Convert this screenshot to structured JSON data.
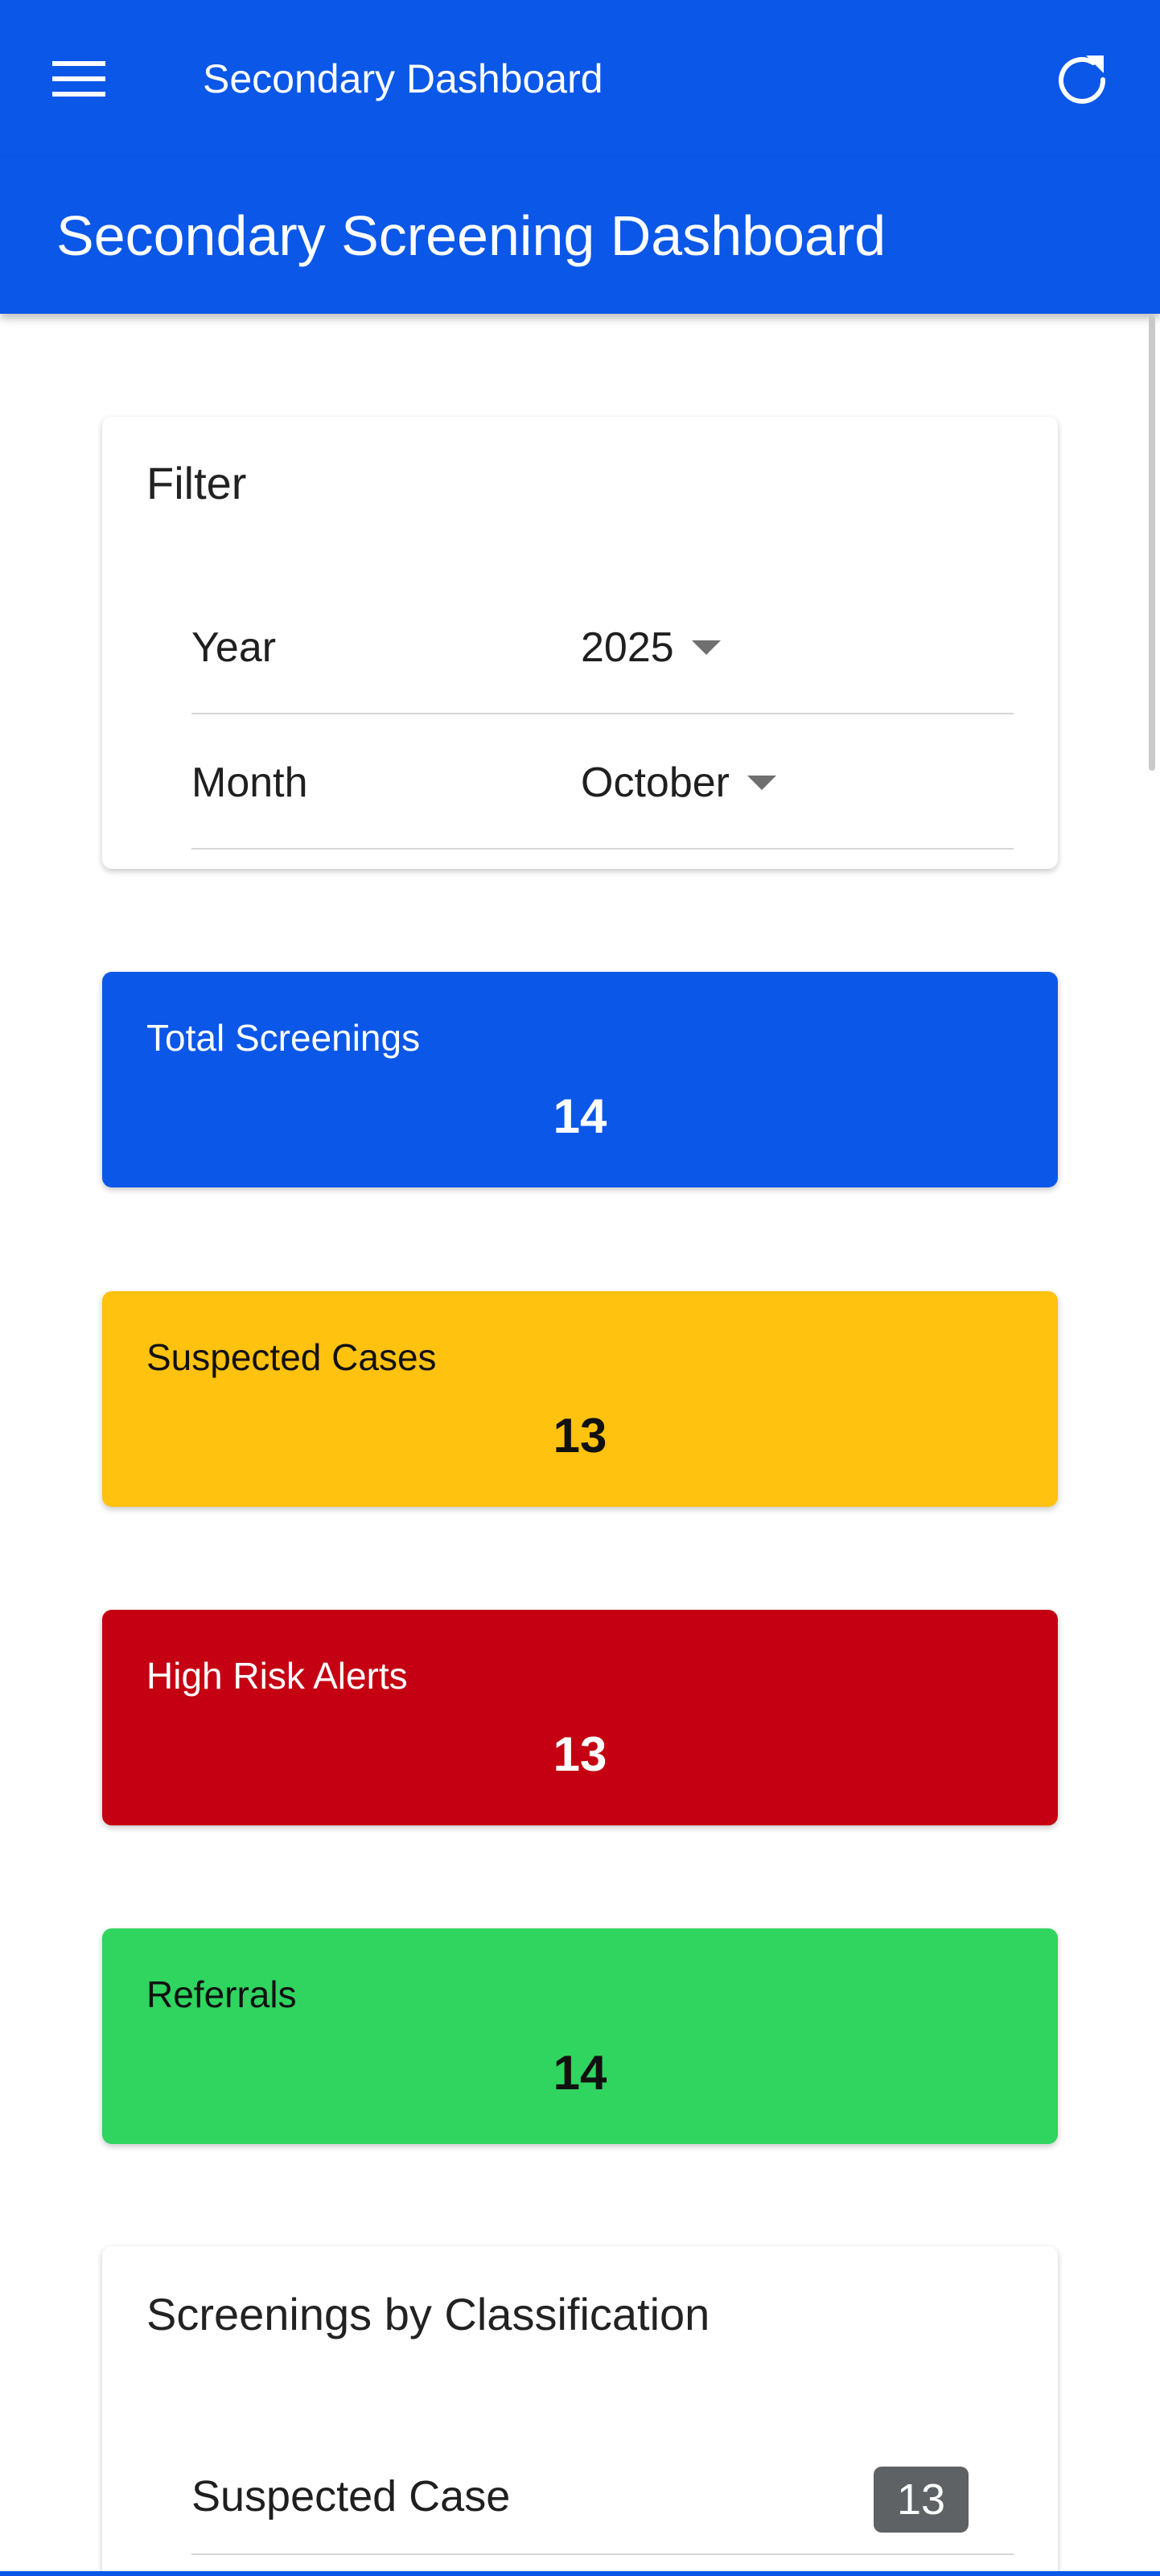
{
  "toolbar": {
    "title": "Secondary Dashboard",
    "menu_icon": "menu-icon",
    "refresh_icon": "refresh-icon",
    "color": "#0b57e8"
  },
  "header": {
    "title": "Secondary Screening Dashboard"
  },
  "filter": {
    "title": "Filter",
    "year_label": "Year",
    "year_value": "2025",
    "month_label": "Month",
    "month_value": "October"
  },
  "stats": [
    {
      "label": "Total Screenings",
      "value": "14",
      "color": "#0b57e8"
    },
    {
      "label": "Suspected Cases",
      "value": "13",
      "color": "#ffc20e"
    },
    {
      "label": "High Risk Alerts",
      "value": "13",
      "color": "#c40012"
    },
    {
      "label": "Referrals",
      "value": "14",
      "color": "#2fd55f"
    }
  ],
  "classification": {
    "title": "Screenings by Classification",
    "rows": [
      {
        "label": "Suspected Case",
        "count": "13"
      }
    ]
  }
}
